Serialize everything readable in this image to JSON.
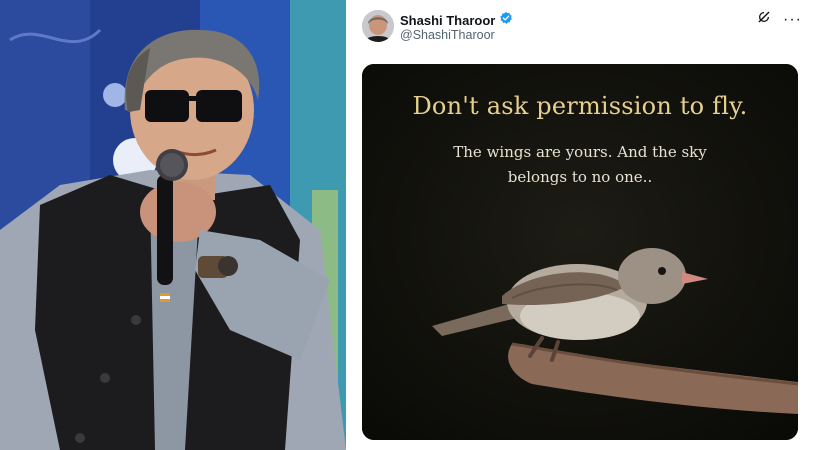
{
  "tweet": {
    "author_name": "Shashi Tharoor",
    "author_handle": "@ShashiTharoor",
    "more_label": "···"
  },
  "media": {
    "title": "Don't ask permission to fly.",
    "lines": [
      "The wings are yours. And the sky",
      "belongs to no one.."
    ]
  },
  "colors": {
    "verified_blue": "#1d9bf0",
    "quote_title": "#e7cf8f",
    "photo_background": "#1f3f8a"
  }
}
